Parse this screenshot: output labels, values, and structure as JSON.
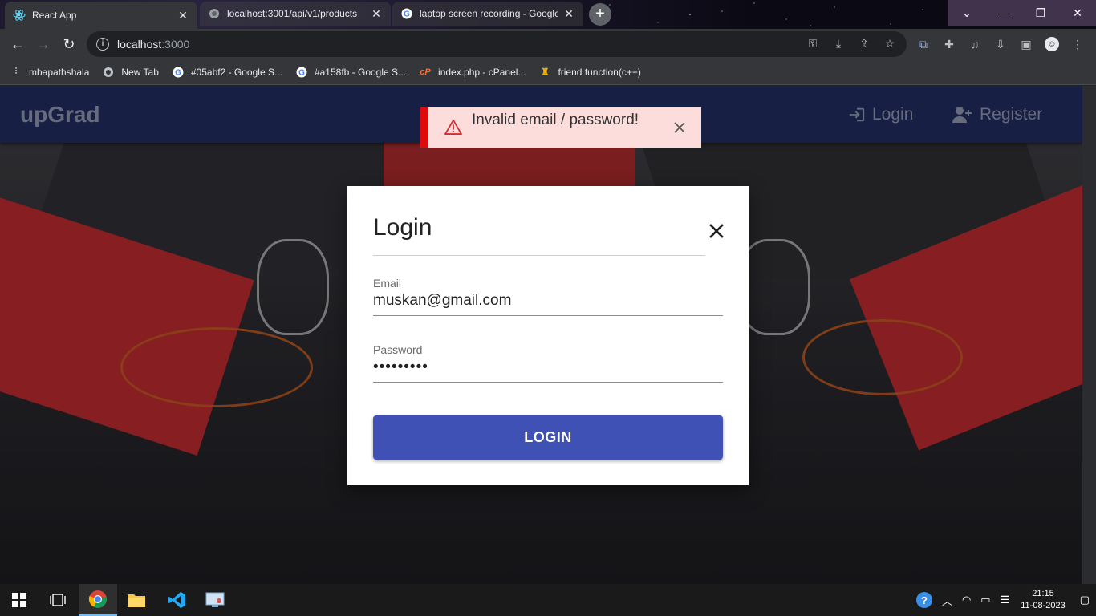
{
  "browser": {
    "tabs": [
      {
        "title": "React App",
        "icon": "react-icon",
        "active": true
      },
      {
        "title": "localhost:3001/api/v1/products",
        "icon": "globe-icon",
        "active": false
      },
      {
        "title": "laptop screen recording - Google",
        "icon": "google-icon",
        "active": false
      }
    ],
    "address": {
      "host": "localhost",
      "port": ":3000"
    },
    "bookmarks": [
      {
        "label": "mbapathshala",
        "icon": "mbapathshala-icon"
      },
      {
        "label": "New Tab",
        "icon": "globe-icon"
      },
      {
        "label": "#05abf2 - Google S...",
        "icon": "google-icon"
      },
      {
        "label": "#a158fb - Google S...",
        "icon": "google-icon"
      },
      {
        "label": "index.php - cPanel...",
        "icon": "cpanel-icon"
      },
      {
        "label": "friend function(c++)",
        "icon": "bookmark-icon"
      }
    ]
  },
  "app": {
    "brand": "upGrad",
    "nav": {
      "login": "Login",
      "register": "Register"
    }
  },
  "alert": {
    "message": "Invalid email / password!",
    "severity_color": "#e10a0a",
    "background": "#fddcdc"
  },
  "dialog": {
    "title": "Login",
    "email_label": "Email",
    "email_value": "muskan@gmail.com",
    "password_label": "Password",
    "password_value": "•••••••••",
    "submit_label": "LOGIN",
    "accent": "#3f51b5"
  },
  "taskbar": {
    "time": "21:15",
    "date": "11-08-2023"
  }
}
